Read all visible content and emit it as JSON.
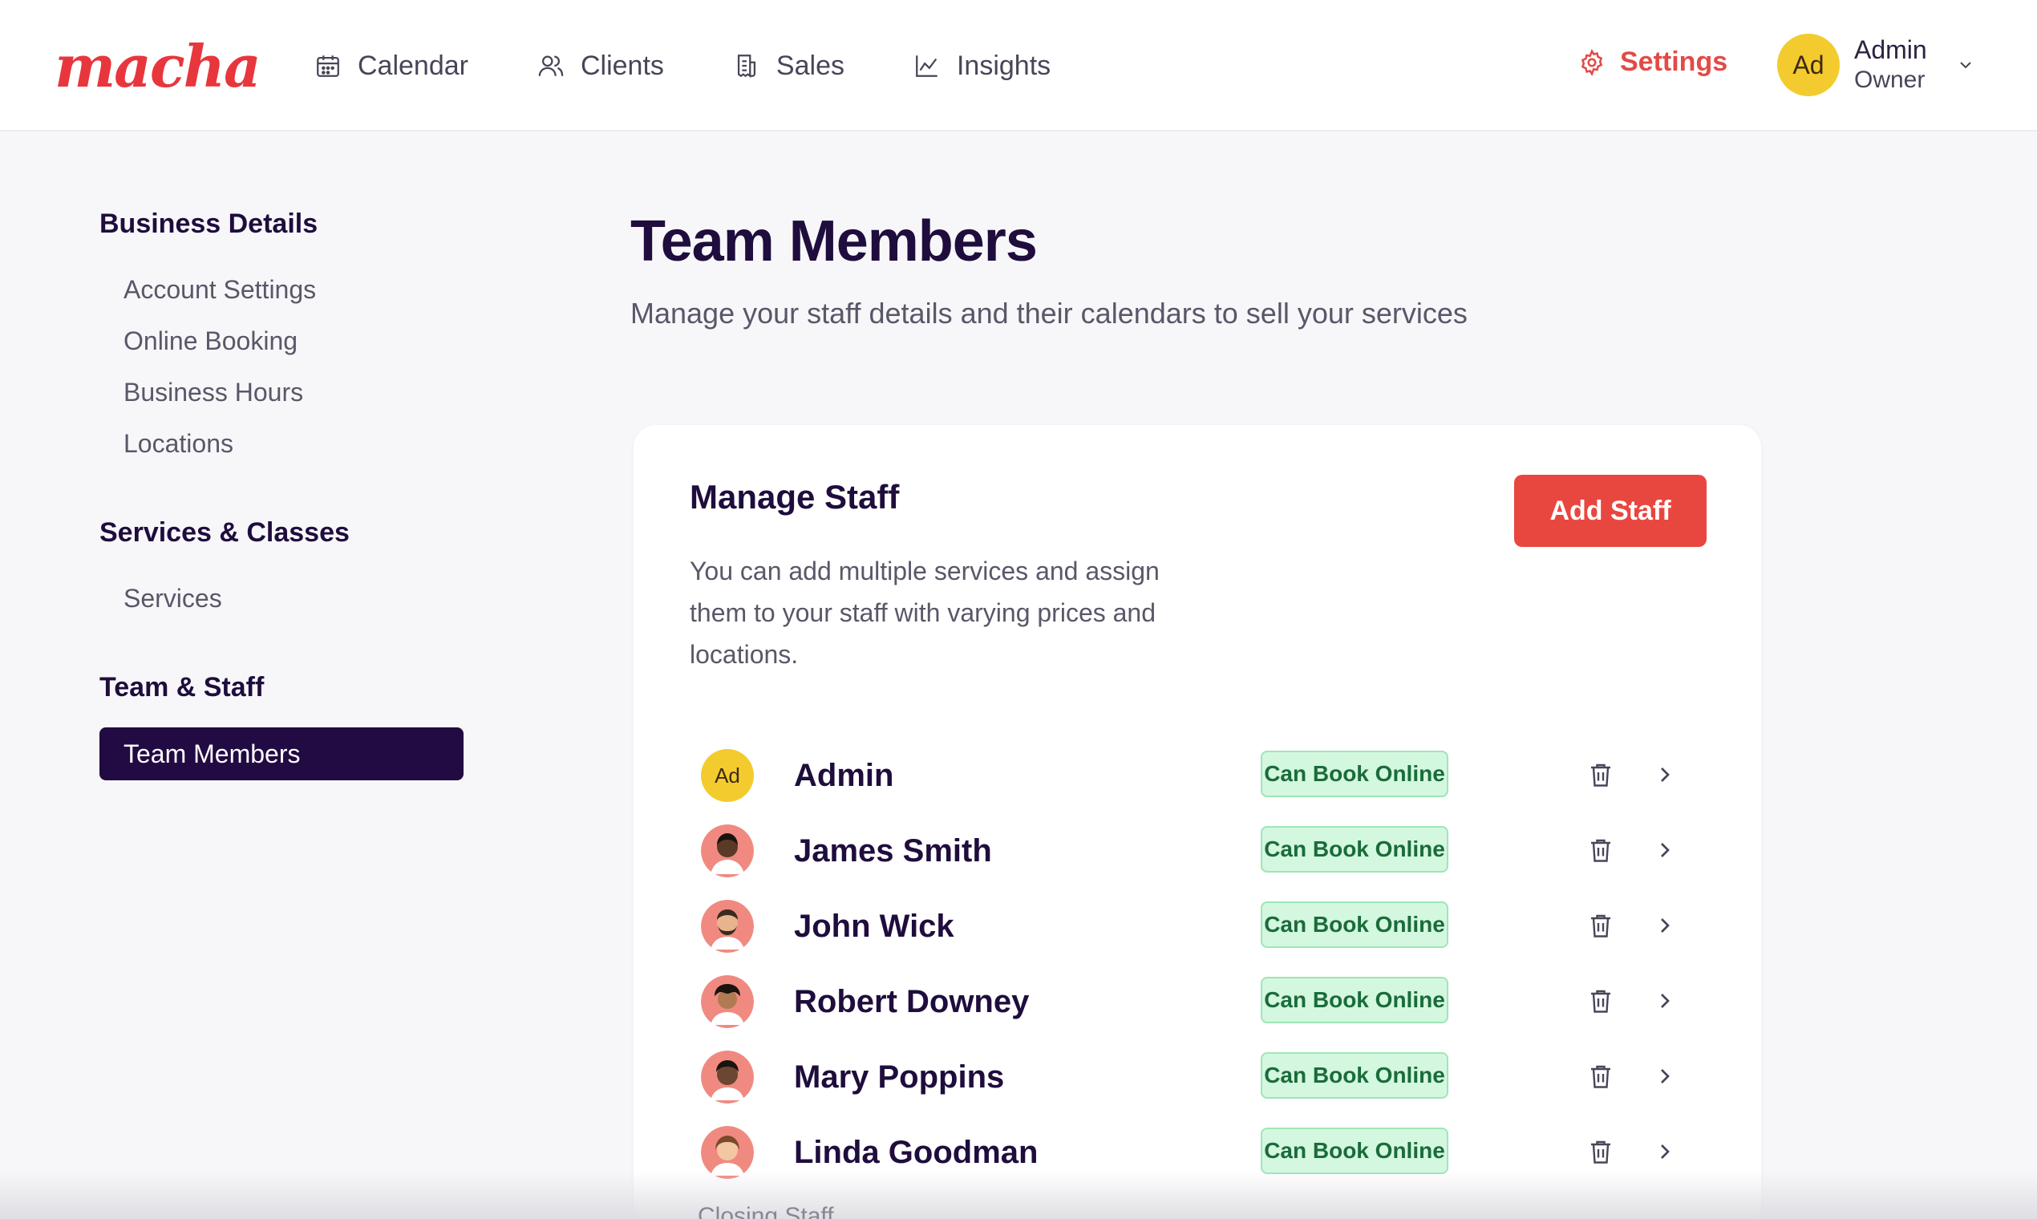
{
  "app": {
    "logo": "macha"
  },
  "nav": [
    {
      "label": "Calendar",
      "icon": "calendar-icon"
    },
    {
      "label": "Clients",
      "icon": "users-icon"
    },
    {
      "label": "Sales",
      "icon": "receipt-icon"
    },
    {
      "label": "Insights",
      "icon": "chart-line-icon"
    }
  ],
  "settings": {
    "label": "Settings",
    "icon": "gear-icon",
    "color": "#e34a46"
  },
  "user": {
    "initials": "Ad",
    "name": "Admin",
    "role": "Owner",
    "avatar_color": "#f3cb2e"
  },
  "sidebar": {
    "groups": [
      {
        "heading": "Business Details",
        "items": [
          "Account Settings",
          "Online Booking",
          "Business Hours",
          "Locations"
        ]
      },
      {
        "heading": "Services & Classes",
        "items": [
          "Services"
        ]
      },
      {
        "heading": "Team & Staff",
        "items": [
          "Team Members"
        ]
      }
    ],
    "active_item": "Team Members"
  },
  "page": {
    "title": "Team Members",
    "subtitle": "Manage your staff details and their calendars to sell your services"
  },
  "card": {
    "title": "Manage Staff",
    "description": "You can add multiple services and assign them to your staff with varying prices and locations.",
    "add_button": "Add Staff",
    "accent": "#e8473f"
  },
  "staff": [
    {
      "name": "Admin",
      "initials": "Ad",
      "badge": "Can Book Online"
    },
    {
      "name": "James Smith",
      "badge": "Can Book Online"
    },
    {
      "name": "John Wick",
      "badge": "Can Book Online"
    },
    {
      "name": "Robert Downey",
      "badge": "Can Book Online"
    },
    {
      "name": "Mary Poppins",
      "badge": "Can Book Online"
    },
    {
      "name": "Linda Goodman",
      "badge": "Can Book Online"
    }
  ],
  "partial_text": "Closing Staff"
}
